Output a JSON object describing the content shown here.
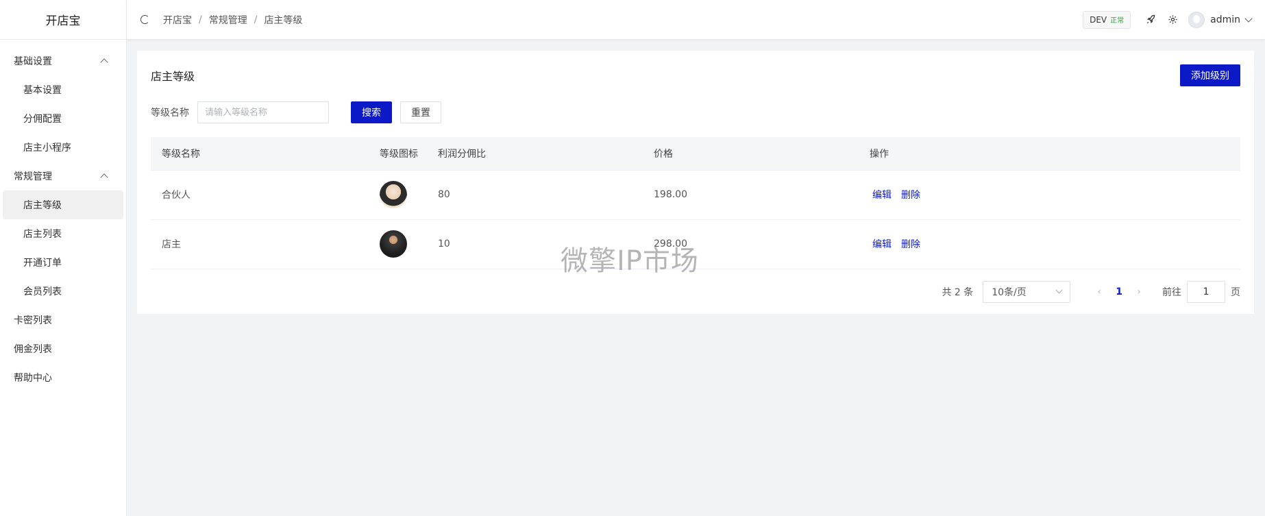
{
  "app": {
    "title": "开店宝"
  },
  "sidebar": {
    "groups": [
      {
        "label": "基础设置",
        "items": [
          "基本设置",
          "分佣配置",
          "店主小程序"
        ]
      },
      {
        "label": "常规管理",
        "items": [
          "店主等级",
          "店主列表",
          "开通订单",
          "会员列表"
        ]
      }
    ],
    "top_items": [
      "卡密列表",
      "佣金列表",
      "帮助中心"
    ],
    "active": "店主等级"
  },
  "header": {
    "breadcrumb": [
      "开店宝",
      "常规管理",
      "店主等级"
    ],
    "env_label": "DEV",
    "env_status": "正常",
    "user": "admin"
  },
  "page": {
    "title": "店主等级",
    "add_button": "添加级别",
    "filter": {
      "label": "等级名称",
      "placeholder": "请输入等级名称",
      "value": "",
      "search_button": "搜索",
      "reset_button": "重置"
    },
    "table": {
      "columns": [
        "等级名称",
        "等级图标",
        "利润分佣比",
        "价格",
        "操作"
      ],
      "rows": [
        {
          "name": "合伙人",
          "icon": "partner-level-icon",
          "ratio": "80",
          "price": "198.00"
        },
        {
          "name": "店主",
          "icon": "owner-level-icon",
          "ratio": "10",
          "price": "298.00"
        }
      ],
      "actions": {
        "edit": "编辑",
        "delete": "删除"
      }
    },
    "pagination": {
      "total": "共 2 条",
      "page_size": "10条/页",
      "prev": "‹",
      "current": "1",
      "next": "›",
      "goto_label": "前往",
      "goto_value": "1",
      "page_suffix": "页"
    }
  },
  "watermark": "微擎IP市场",
  "colors": {
    "primary": "#0b19c6",
    "status_ok": "#35a745"
  }
}
